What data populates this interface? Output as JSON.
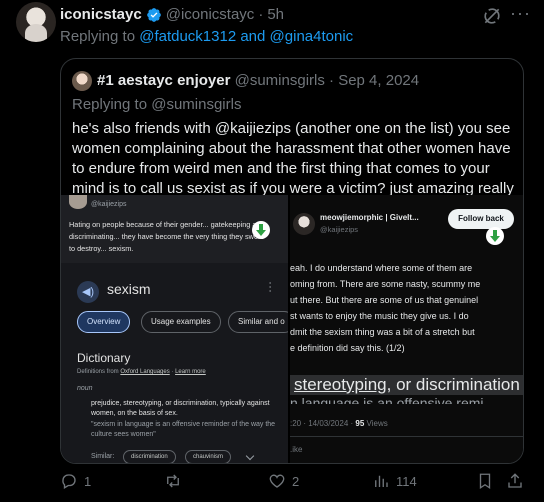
{
  "tweet": {
    "display_name": "iconicstayc",
    "handle": "@iconicstayc",
    "separator": "·",
    "time": "5h",
    "replying_prefix": "Replying to",
    "replying_users": "@fatduck1312 and @gina4tonic"
  },
  "quote": {
    "display_name": "#1 aestayc enjoyer",
    "handle": "@suminsgirls",
    "separator": "·",
    "date": "Sep 4, 2024",
    "replying": "Replying to @suminsgirls",
    "text": "he's also friends with @kaijiezips (another one on the list) you see women complaining about the harassment that other women have to endure from weird men and the first thing that comes to your mind is to call us sexist as if you were a victim? just amazing really"
  },
  "shot_left": {
    "handle": "@kaijiezips",
    "body": "Hating on people because of their gender... gatekeeping and discriminating... they have become the very thing they swore to destroy... sexism.",
    "term": "sexism",
    "tabs": [
      "Overview",
      "Usage examples",
      "Similar and o"
    ],
    "dictionary_title": "Dictionary",
    "defs_prefix": "Definitions from",
    "defs_source": "Oxford Languages",
    "defs_sep": "·",
    "learn_more": "Learn more",
    "pos": "noun",
    "definition": "prejudice, stereotyping, or discrimination, typically against women, on the basis of sex.",
    "example": "\"sexism in language is an offensive reminder of the way the culture sees women\"",
    "similar_label": "Similar:",
    "similar_chips": [
      "discrimination",
      "chauvinism"
    ]
  },
  "shot_right": {
    "name": "meowjiemorphic | GiveIt...",
    "handle": "@kaijiezips",
    "follow_label": "Follow back",
    "body_lines": [
      "eah. I do understand where some of them are",
      "oming from. There are some nasty, scummy me",
      "ut there. But there are some of us that genuinel",
      "st wants to enjoy the music they give us. I do",
      "dmit the sexism thing was a bit of a stretch but",
      "e definition did say this. (1/2)"
    ],
    "big_text_pre": "stereotyping",
    "big_text_post": ", or discrimination",
    "big_text_line2": "n language is an offensive remi",
    "meta_time": ":20 · 14/03/2024 ·",
    "meta_views_count": "95",
    "meta_views_label": "Views",
    "like_label": ".ike"
  },
  "actions": {
    "replies": "1",
    "reposts": "",
    "likes": "2",
    "views": "114"
  },
  "colors": {
    "accent": "#1d9bf0",
    "muted": "#71767b",
    "background": "#000000"
  },
  "icons": [
    "verified-badge-icon",
    "grok-icon",
    "more-icon",
    "download-icon",
    "speaker-icon",
    "reply-icon",
    "repost-icon",
    "like-icon",
    "views-icon",
    "bookmark-icon",
    "share-icon"
  ]
}
